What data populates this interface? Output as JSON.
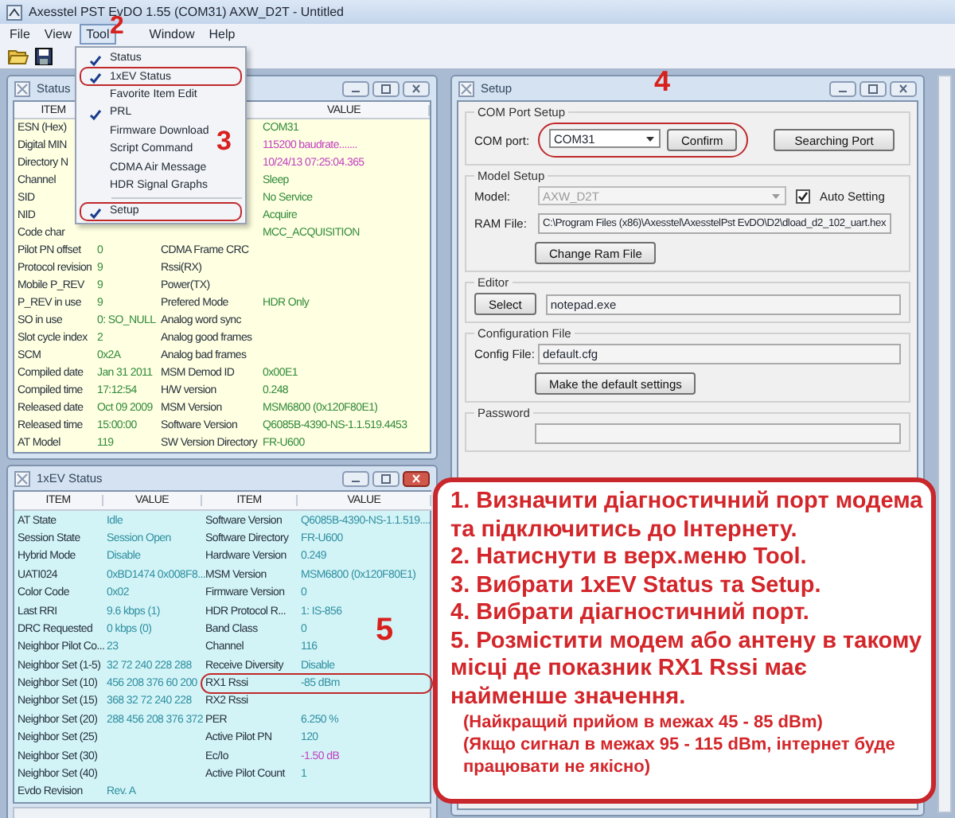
{
  "window": {
    "title": "Axesstel PST EvDO 1.55 (COM31) AXW_D2T - Untitled"
  },
  "menu_bar": [
    {
      "label": "File",
      "selected": false
    },
    {
      "label": "View",
      "selected": false
    },
    {
      "label": "Tool",
      "selected": true
    },
    {
      "label": "Window",
      "selected": false
    },
    {
      "label": "Help",
      "selected": false
    }
  ],
  "tool_menu": [
    {
      "label": "Status",
      "checked": true,
      "highlighted": false,
      "separator_before": false
    },
    {
      "label": "1xEV Status",
      "checked": true,
      "highlighted": true,
      "separator_before": false
    },
    {
      "label": "Favorite Item Edit",
      "checked": false,
      "highlighted": false,
      "separator_before": false
    },
    {
      "label": "PRL",
      "checked": true,
      "highlighted": false,
      "separator_before": false
    },
    {
      "label": "Firmware Download",
      "checked": false,
      "highlighted": false,
      "separator_before": false
    },
    {
      "label": "Script Command",
      "checked": false,
      "highlighted": false,
      "separator_before": false
    },
    {
      "label": "CDMA Air Message",
      "checked": false,
      "highlighted": false,
      "separator_before": false
    },
    {
      "label": "HDR Signal Graphs",
      "checked": false,
      "highlighted": false,
      "separator_before": false
    },
    {
      "label": "Setup",
      "checked": true,
      "highlighted": true,
      "separator_before": true
    }
  ],
  "status_window": {
    "title": "Status",
    "active": false,
    "column_1": "ITEM",
    "column_4": "VALUE",
    "rows": [
      {
        "item": "ESN (Hex)",
        "value2": "COM31"
      },
      {
        "item": "Digital MIN",
        "value2": "115200 baudrate.......",
        "color": "#c040c0"
      },
      {
        "item": "Directory N",
        "value2": "10/24/13 07:25:04.365",
        "color": "#c040c0"
      },
      {
        "item": "Channel",
        "value2": "Sleep"
      },
      {
        "item": "SID",
        "value2": "No Service"
      },
      {
        "item": "NID",
        "value2": "Acquire"
      },
      {
        "item": "Code char",
        "value2": "MCC_ACQUISITION"
      },
      {
        "item": "Pilot PN offset",
        "value": "0",
        "item2": "CDMA Frame CRC"
      },
      {
        "item": "Protocol revision",
        "value": "9",
        "item2": "Rssi(RX)"
      },
      {
        "item": "Mobile P_REV",
        "value": "9",
        "item2": "Power(TX)"
      },
      {
        "item": "P_REV in use",
        "value": "9",
        "item2": "Prefered Mode",
        "value2": "HDR Only"
      },
      {
        "item": "SO in use",
        "value": "0: SO_NULL",
        "item2": "Analog word sync"
      },
      {
        "item": "Slot cycle index",
        "value": "2",
        "item2": "Analog good frames"
      },
      {
        "item": "SCM",
        "value": "0x2A",
        "item2": "Analog bad frames"
      },
      {
        "item": "Compiled date",
        "value": "Jan 31 2011",
        "item2": "MSM Demod ID",
        "value2": "0x00E1"
      },
      {
        "item": "Compiled time",
        "value": "17:12:54",
        "item2": "H/W version",
        "value2": "0.248"
      },
      {
        "item": "Released date",
        "value": "Oct 09 2009",
        "item2": "MSM Version",
        "value2": "MSM6800 (0x120F80E1)"
      },
      {
        "item": "Released time",
        "value": "15:00:00",
        "item2": "Software Version",
        "value2": "Q6085B-4390-NS-1.1.519.4453"
      },
      {
        "item": "AT Model",
        "value": "119",
        "item2": "SW Version Directory",
        "value2": "FR-U600"
      }
    ]
  },
  "ev_window": {
    "title": "1xEV Status",
    "active": true,
    "columns": [
      "ITEM",
      "VALUE",
      "ITEM",
      "VALUE"
    ],
    "rows": [
      {
        "item": "AT State",
        "value": "Idle",
        "item2": "Software Version",
        "value2": "Q6085B-4390-NS-1.1.519...."
      },
      {
        "item": "Session State",
        "value": "Session Open",
        "item2": "Software Directory",
        "value2": "FR-U600"
      },
      {
        "item": "Hybrid Mode",
        "value": "Disable",
        "item2": "Hardware Version",
        "value2": "0.249"
      },
      {
        "item": "UATI024",
        "value": "0xBD1474 0x008F8...",
        "item2": "MSM Version",
        "value2": "MSM6800 (0x120F80E1)"
      },
      {
        "item": "Color Code",
        "value": "0x02",
        "item2": "Firmware Version",
        "value2": "0"
      },
      {
        "item": "Last RRI",
        "value": "9.6 kbps (1)",
        "item2": "HDR Protocol R...",
        "value2": "1: IS-856"
      },
      {
        "item": "DRC Requested",
        "value": "0 kbps (0)",
        "item2": "Band Class",
        "value2": "0"
      },
      {
        "item": "Neighbor Pilot Co...",
        "value": "23",
        "item2": "Channel",
        "value2": "116"
      },
      {
        "item": "Neighbor Set (1-5)",
        "value": "32 72 240 228 288",
        "item2": "Receive Diversity",
        "value2": "Disable"
      },
      {
        "item": "Neighbor Set (10)",
        "value": "456 208 376 60 200",
        "item2": "RX1 Rssi",
        "value2": "-85 dBm",
        "highlighted": true
      },
      {
        "item": "Neighbor Set (15)",
        "value": "368 32 72 240 228",
        "item2": "RX2 Rssi"
      },
      {
        "item": "Neighbor Set (20)",
        "value": "288 456 208 376 372",
        "item2": "PER",
        "value2": "6.250 %"
      },
      {
        "item": "Neighbor Set (25)",
        "item2": "Active Pilot PN",
        "value2": "120"
      },
      {
        "item": "Neighbor Set (30)",
        "item2": "Ec/Io",
        "value2": "-1.50 dB",
        "color": "#c040c0"
      },
      {
        "item": "Neighbor Set (40)",
        "item2": "Active Pilot Count",
        "value2": "1"
      },
      {
        "item": "Evdo Revision",
        "value": "Rev. A"
      }
    ]
  },
  "setup_window": {
    "title": "Setup",
    "active": false,
    "com_group": {
      "title": "COM Port Setup",
      "label": "COM port:",
      "port": "COM31",
      "confirm": "Confirm",
      "search": "Searching Port",
      "highlighted": true
    },
    "model_group": {
      "title": "Model Setup",
      "model_label": "Model:",
      "model": "AXW_D2T",
      "model_disabled": true,
      "auto_label": "Auto Setting",
      "auto_checked": true,
      "ram_label": "RAM File:",
      "ram_file": "C:\\Program Files (x86)\\Axesstel\\AxesstelPst EvDO\\D2\\dload_d2_102_uart.hex",
      "ram_button": "Change Ram File"
    },
    "editor_group": {
      "title": "Editor",
      "button": "Select",
      "value": "notepad.exe"
    },
    "config_group": {
      "title": "Configuration File",
      "label": "Config File:",
      "value": "default.cfg",
      "button": "Make the default settings"
    },
    "password_group": {
      "title": "Password"
    }
  },
  "annotations": [
    "2",
    "3",
    "4",
    "5"
  ],
  "instructions": {
    "steps": [
      "1. Визначити діагностичний порт модема та підключитись до Інтернету.",
      "2. Натиснути в верх.меню Tool.",
      "3. Вибрати 1xEV Status та Setup.",
      "4. Вибрати діагностичний порт.",
      "5. Розмістити модем або антену в такому місці де показник RX1 Rssi має найменше значення."
    ],
    "notes": [
      "(Найкращий прийом в межах 45 - 85 dBm)",
      "(Якщо сигнал в межах 95 - 115 dBm, інтернет буде працювати не якісно)"
    ]
  }
}
